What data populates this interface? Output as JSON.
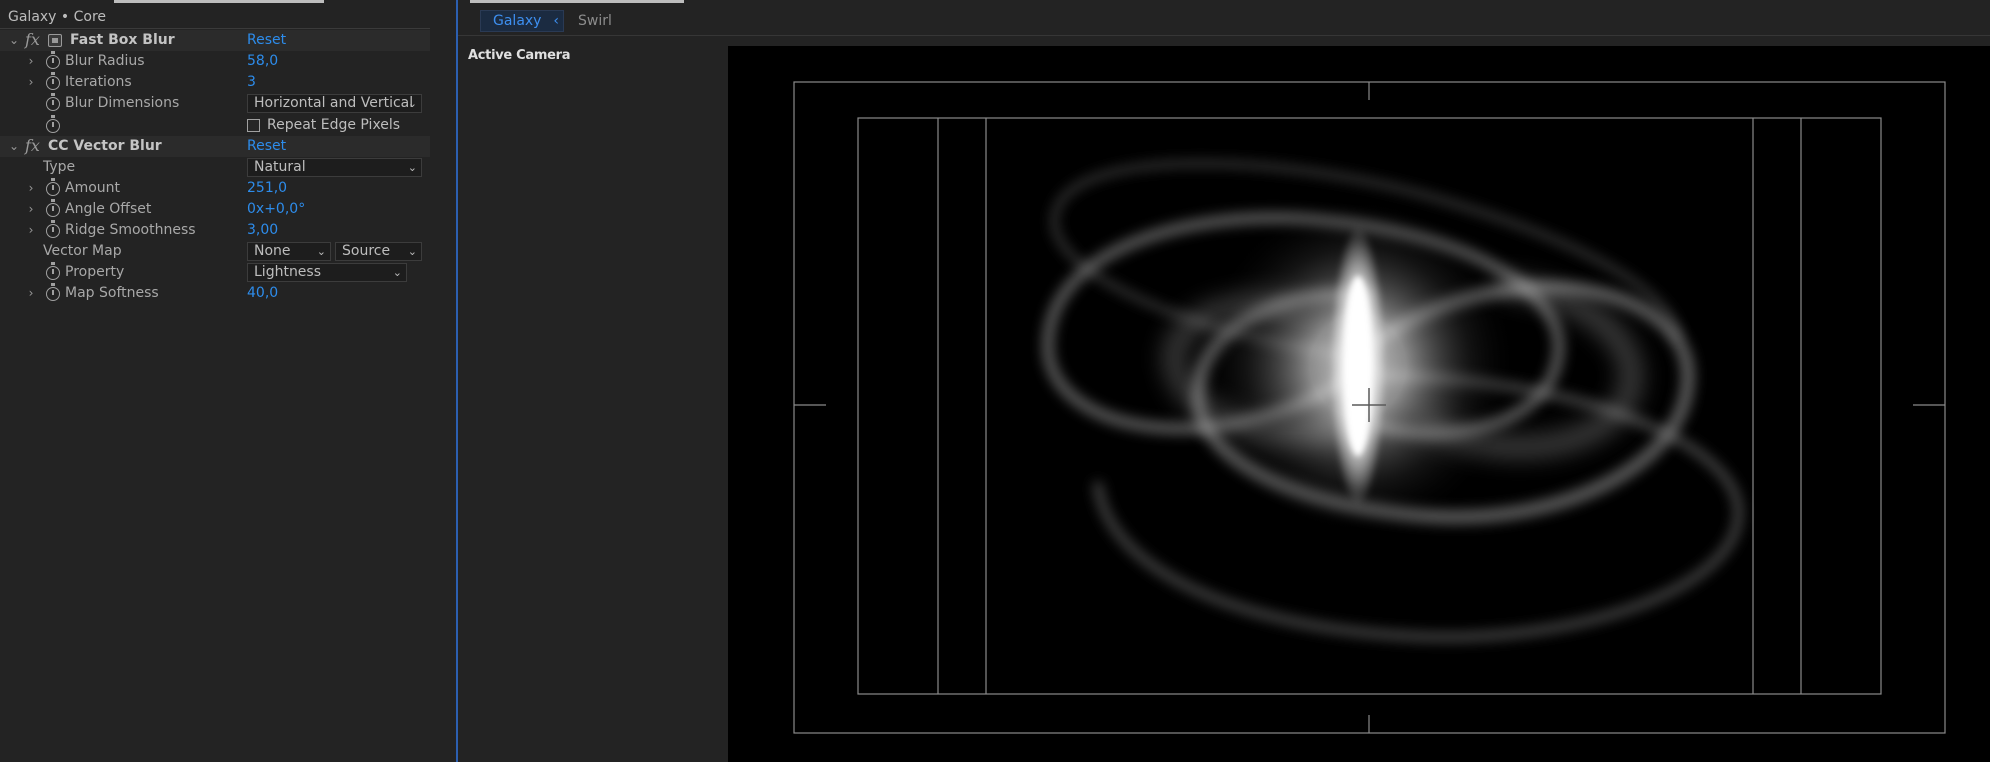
{
  "effect_controls": {
    "breadcrumb": "Galaxy • Core",
    "fast_box_blur": {
      "fx": "fx",
      "name": "Fast Box Blur",
      "reset": "Reset",
      "blur_radius_label": "Blur Radius",
      "blur_radius_value": "58,0",
      "iterations_label": "Iterations",
      "iterations_value": "3",
      "blur_dimensions_label": "Blur Dimensions",
      "blur_dimensions_value": "Horizontal and Vertical",
      "repeat_edge_label": "Repeat Edge Pixels",
      "repeat_edge_checked": false
    },
    "cc_vector_blur": {
      "fx": "fx",
      "name": "CC Vector Blur",
      "reset": "Reset",
      "type_label": "Type",
      "type_value": "Natural",
      "amount_label": "Amount",
      "amount_value": "251,0",
      "angle_offset_label": "Angle Offset",
      "angle_offset_value": "0x+0,0°",
      "ridge_label": "Ridge Smoothness",
      "ridge_value": "3,00",
      "vector_map_label": "Vector Map",
      "vector_map_value": "None",
      "vector_map_source": "Source",
      "property_label": "Property",
      "property_value": "Lightness",
      "map_softness_label": "Map Softness",
      "map_softness_value": "40,0"
    }
  },
  "viewer": {
    "tabs": [
      {
        "label": "Galaxy",
        "active": true
      },
      {
        "label": "Swirl",
        "active": false
      }
    ],
    "camera_label": "Active Camera"
  },
  "colors": {
    "accent": "#2d8ceb",
    "panel_bg": "#232323",
    "canvas_bg": "#000000",
    "guide": "#8a8a8a"
  },
  "icons": [
    "fx-icon",
    "gpu-accelerated-icon",
    "stopwatch-icon",
    "chevron-right-icon",
    "chevron-down-icon",
    "chevron-left-icon",
    "checkbox-icon",
    "crosshair-icon"
  ]
}
